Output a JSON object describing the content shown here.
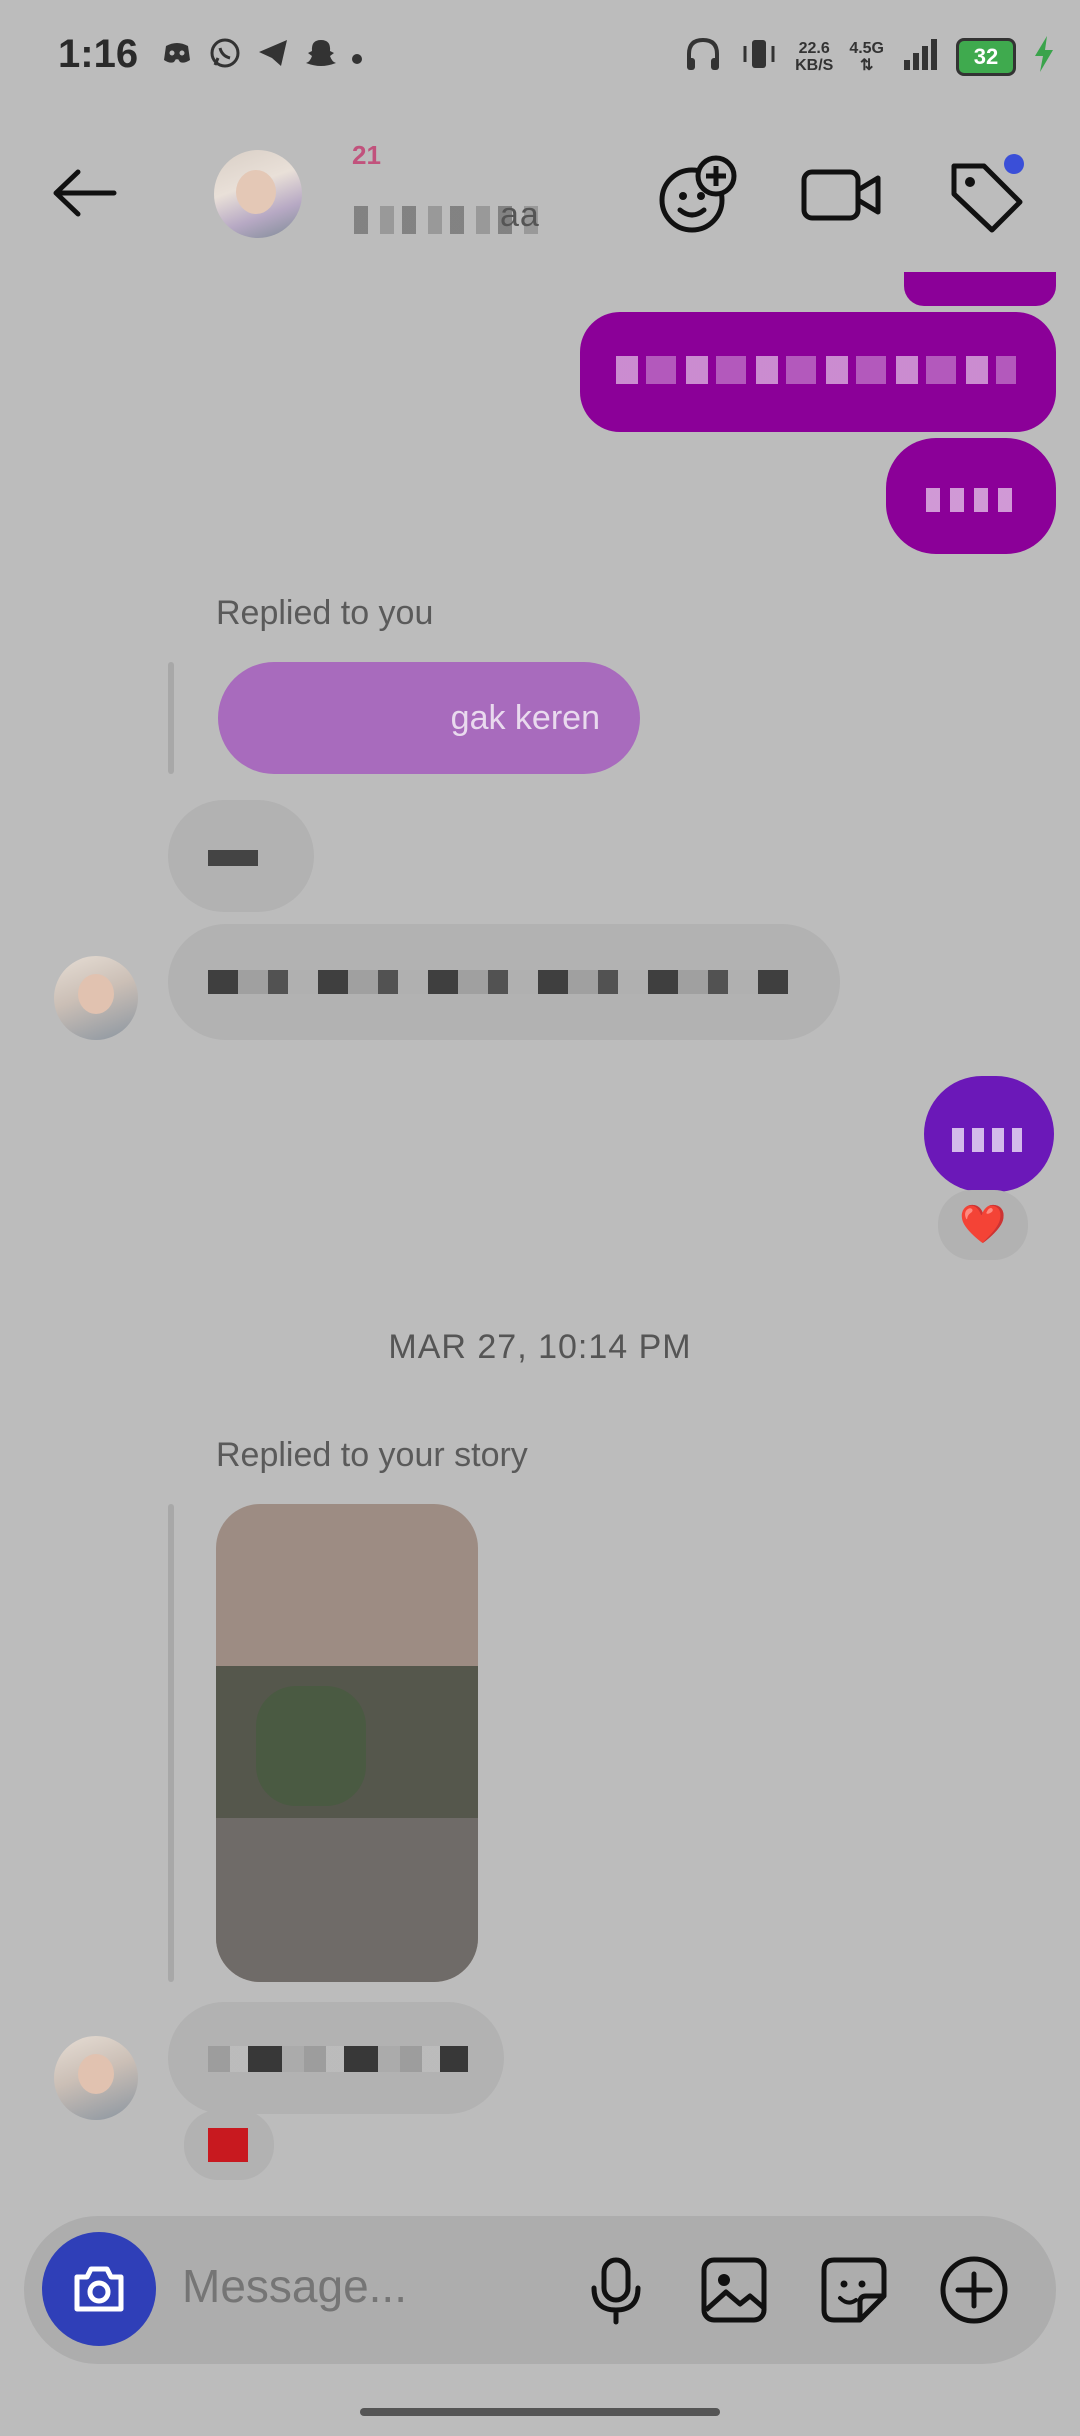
{
  "status_bar": {
    "time": "1:16",
    "net_speed_value": "22.6",
    "net_speed_unit": "KB/S",
    "network": "4.5G",
    "battery": "32"
  },
  "header": {
    "badge_number": "21",
    "contact_name_visible": "aa"
  },
  "messages": {
    "replied_to_you_label": "Replied to you",
    "replied_bubble_text": "gak keren",
    "date_separator": "MAR 27, 10:14 PM",
    "replied_story_label": "Replied to your story",
    "heart_reaction": "❤️"
  },
  "composer": {
    "placeholder": "Message..."
  },
  "colors": {
    "outgoing_bubble": "#8b0098",
    "outgoing_bubble_alt": "#6b18b8",
    "reply_bubble": "#a86bbd",
    "camera_button": "#2f3fb8",
    "notification_dot": "#3a4fd8"
  }
}
